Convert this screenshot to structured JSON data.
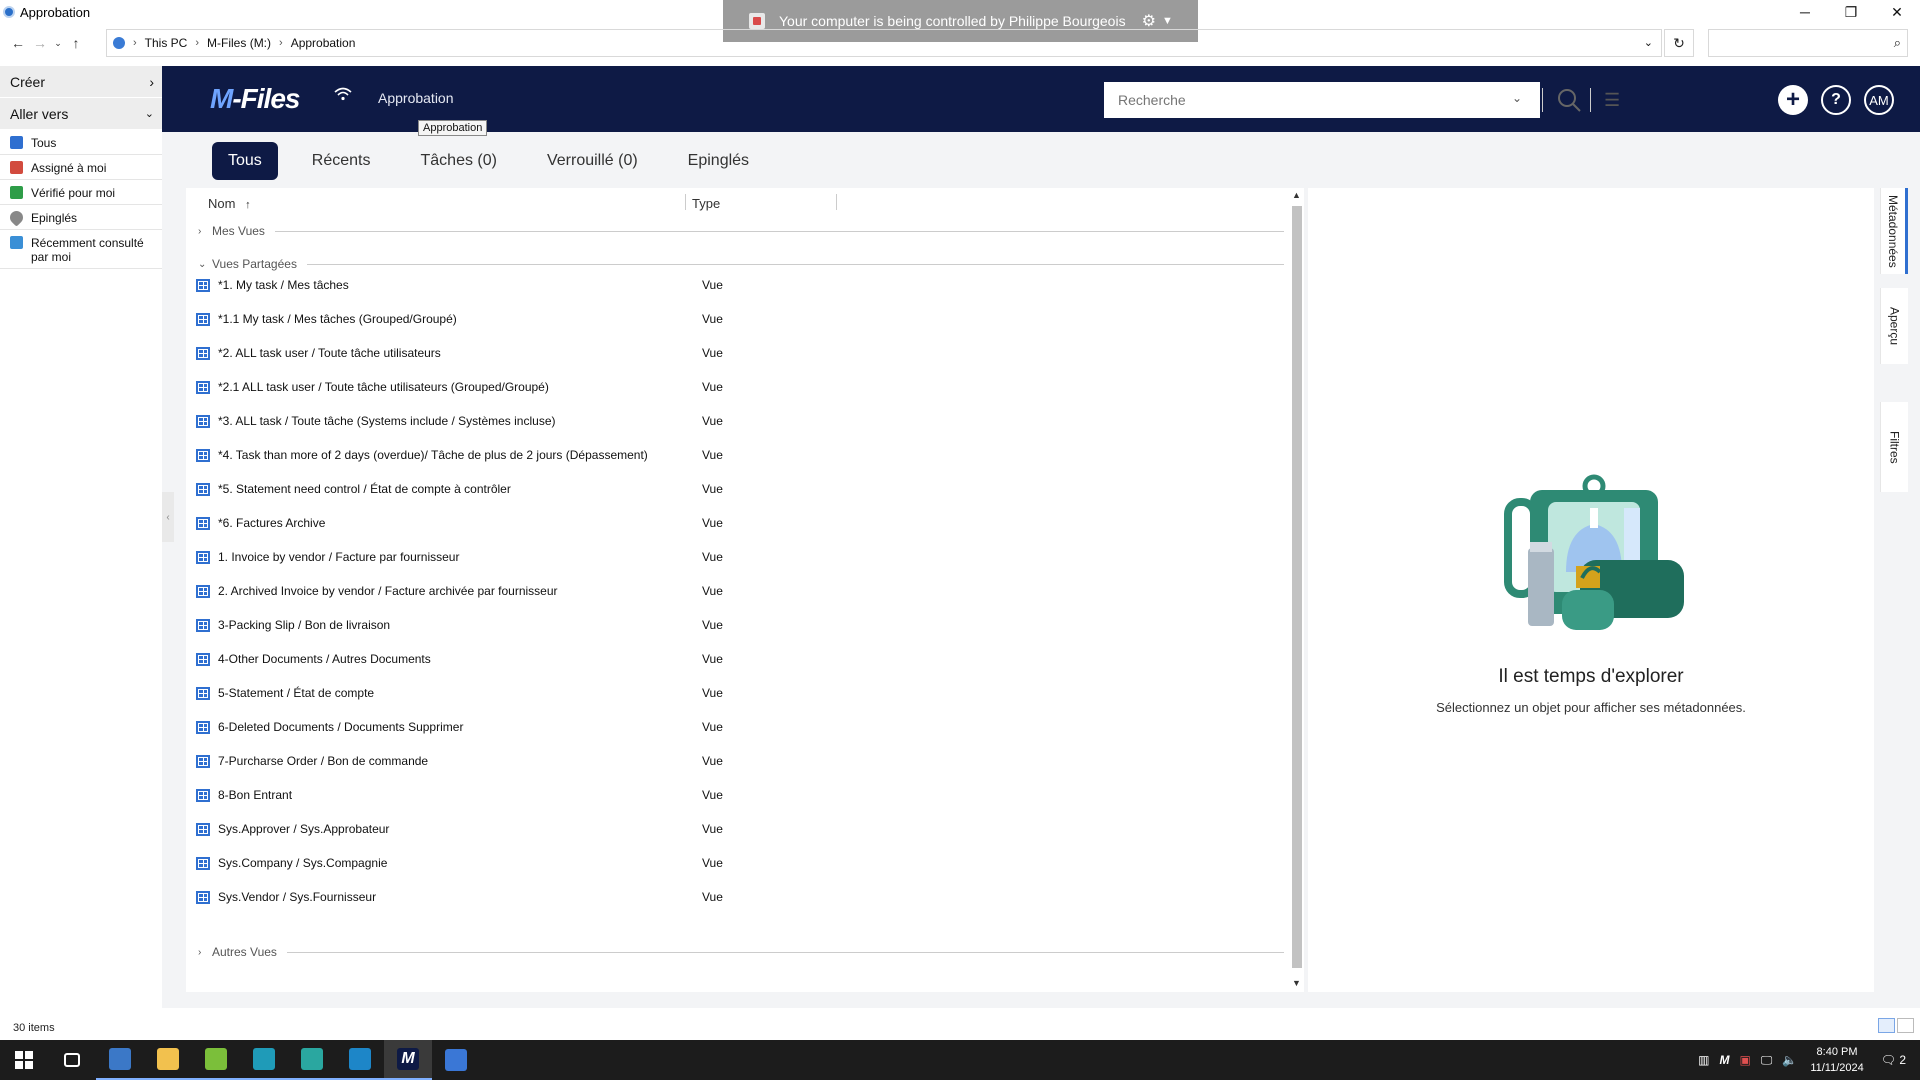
{
  "window": {
    "title": "Approbation",
    "controls": [
      "─",
      "❐",
      "✕"
    ]
  },
  "remote_banner": {
    "text": "Your computer is being controlled by Philippe Bourgeois"
  },
  "address": {
    "crumbs": [
      "This PC",
      "M-Files (M:)",
      "Approbation"
    ]
  },
  "sidebar": {
    "create_label": "Créer",
    "goto_label": "Aller vers",
    "items": [
      {
        "label": "Tous",
        "color": "#2f6fd0"
      },
      {
        "label": "Assigné à moi",
        "color": "#d24b3e"
      },
      {
        "label": "Vérifié pour moi",
        "color": "#2e9d48"
      },
      {
        "label": "Epinglés",
        "color": "#666666"
      },
      {
        "label": "Récemment consulté par moi",
        "color": "#3a8fd6"
      }
    ],
    "status": "30 items"
  },
  "header": {
    "logo_prefix": "M",
    "logo_rest": "-Files",
    "vault_name": "Approbation",
    "tooltip": "Approbation",
    "search_placeholder": "Recherche",
    "avatar": "AM",
    "help": "?",
    "plus": "+"
  },
  "tabs": [
    {
      "label": "Tous",
      "active": true
    },
    {
      "label": "Récents"
    },
    {
      "label": "Tâches (0)"
    },
    {
      "label": "Verrouillé (0)"
    },
    {
      "label": "Epinglés"
    }
  ],
  "list": {
    "col_name": "Nom",
    "col_type": "Type",
    "groups": {
      "mine": "Mes Vues",
      "shared": "Vues Partagées",
      "other": "Autres Vues"
    },
    "rows": [
      {
        "name": "*1. My task / Mes tâches",
        "type": "Vue"
      },
      {
        "name": "*1.1 My task / Mes tâches (Grouped/Groupé)",
        "type": "Vue"
      },
      {
        "name": "*2. ALL task user / Toute tâche utilisateurs",
        "type": "Vue"
      },
      {
        "name": "*2.1 ALL task user / Toute tâche utilisateurs (Grouped/Groupé)",
        "type": "Vue"
      },
      {
        "name": "*3. ALL task  / Toute tâche (Systems include / Systèmes incluse)",
        "type": "Vue"
      },
      {
        "name": "*4. Task than more of 2 days (overdue)/ Tâche de plus de 2 jours (Dépassement)",
        "type": "Vue"
      },
      {
        "name": "*5. Statement need control / État de compte à contrôler",
        "type": "Vue"
      },
      {
        "name": "*6. Factures Archive",
        "type": "Vue"
      },
      {
        "name": "1. Invoice by vendor / Facture par fournisseur",
        "type": "Vue"
      },
      {
        "name": "2. Archived Invoice by vendor / Facture archivée par fournisseur",
        "type": "Vue"
      },
      {
        "name": "3-Packing Slip / Bon de livraison",
        "type": "Vue"
      },
      {
        "name": "4-Other Documents / Autres Documents",
        "type": "Vue"
      },
      {
        "name": "5-Statement / État de compte",
        "type": "Vue"
      },
      {
        "name": "6-Deleted Documents / Documents Supprimer",
        "type": "Vue"
      },
      {
        "name": "7-Purcharse Order / Bon de commande",
        "type": "Vue"
      },
      {
        "name": "8-Bon Entrant",
        "type": "Vue"
      },
      {
        "name": "Sys.Approver / Sys.Approbateur",
        "type": "Vue"
      },
      {
        "name": "Sys.Company / Sys.Compagnie",
        "type": "Vue"
      },
      {
        "name": "Sys.Vendor / Sys.Fournisseur",
        "type": "Vue"
      }
    ]
  },
  "details": {
    "title": "Il est temps d'explorer",
    "subtitle": "Sélectionnez un objet pour afficher ses métadonnées."
  },
  "side_tabs": [
    "Métadonnées",
    "Aperçu",
    "Filtres"
  ],
  "taskbar": {
    "time": "8:40 PM",
    "date": "11/11/2024",
    "notifications": "2"
  }
}
